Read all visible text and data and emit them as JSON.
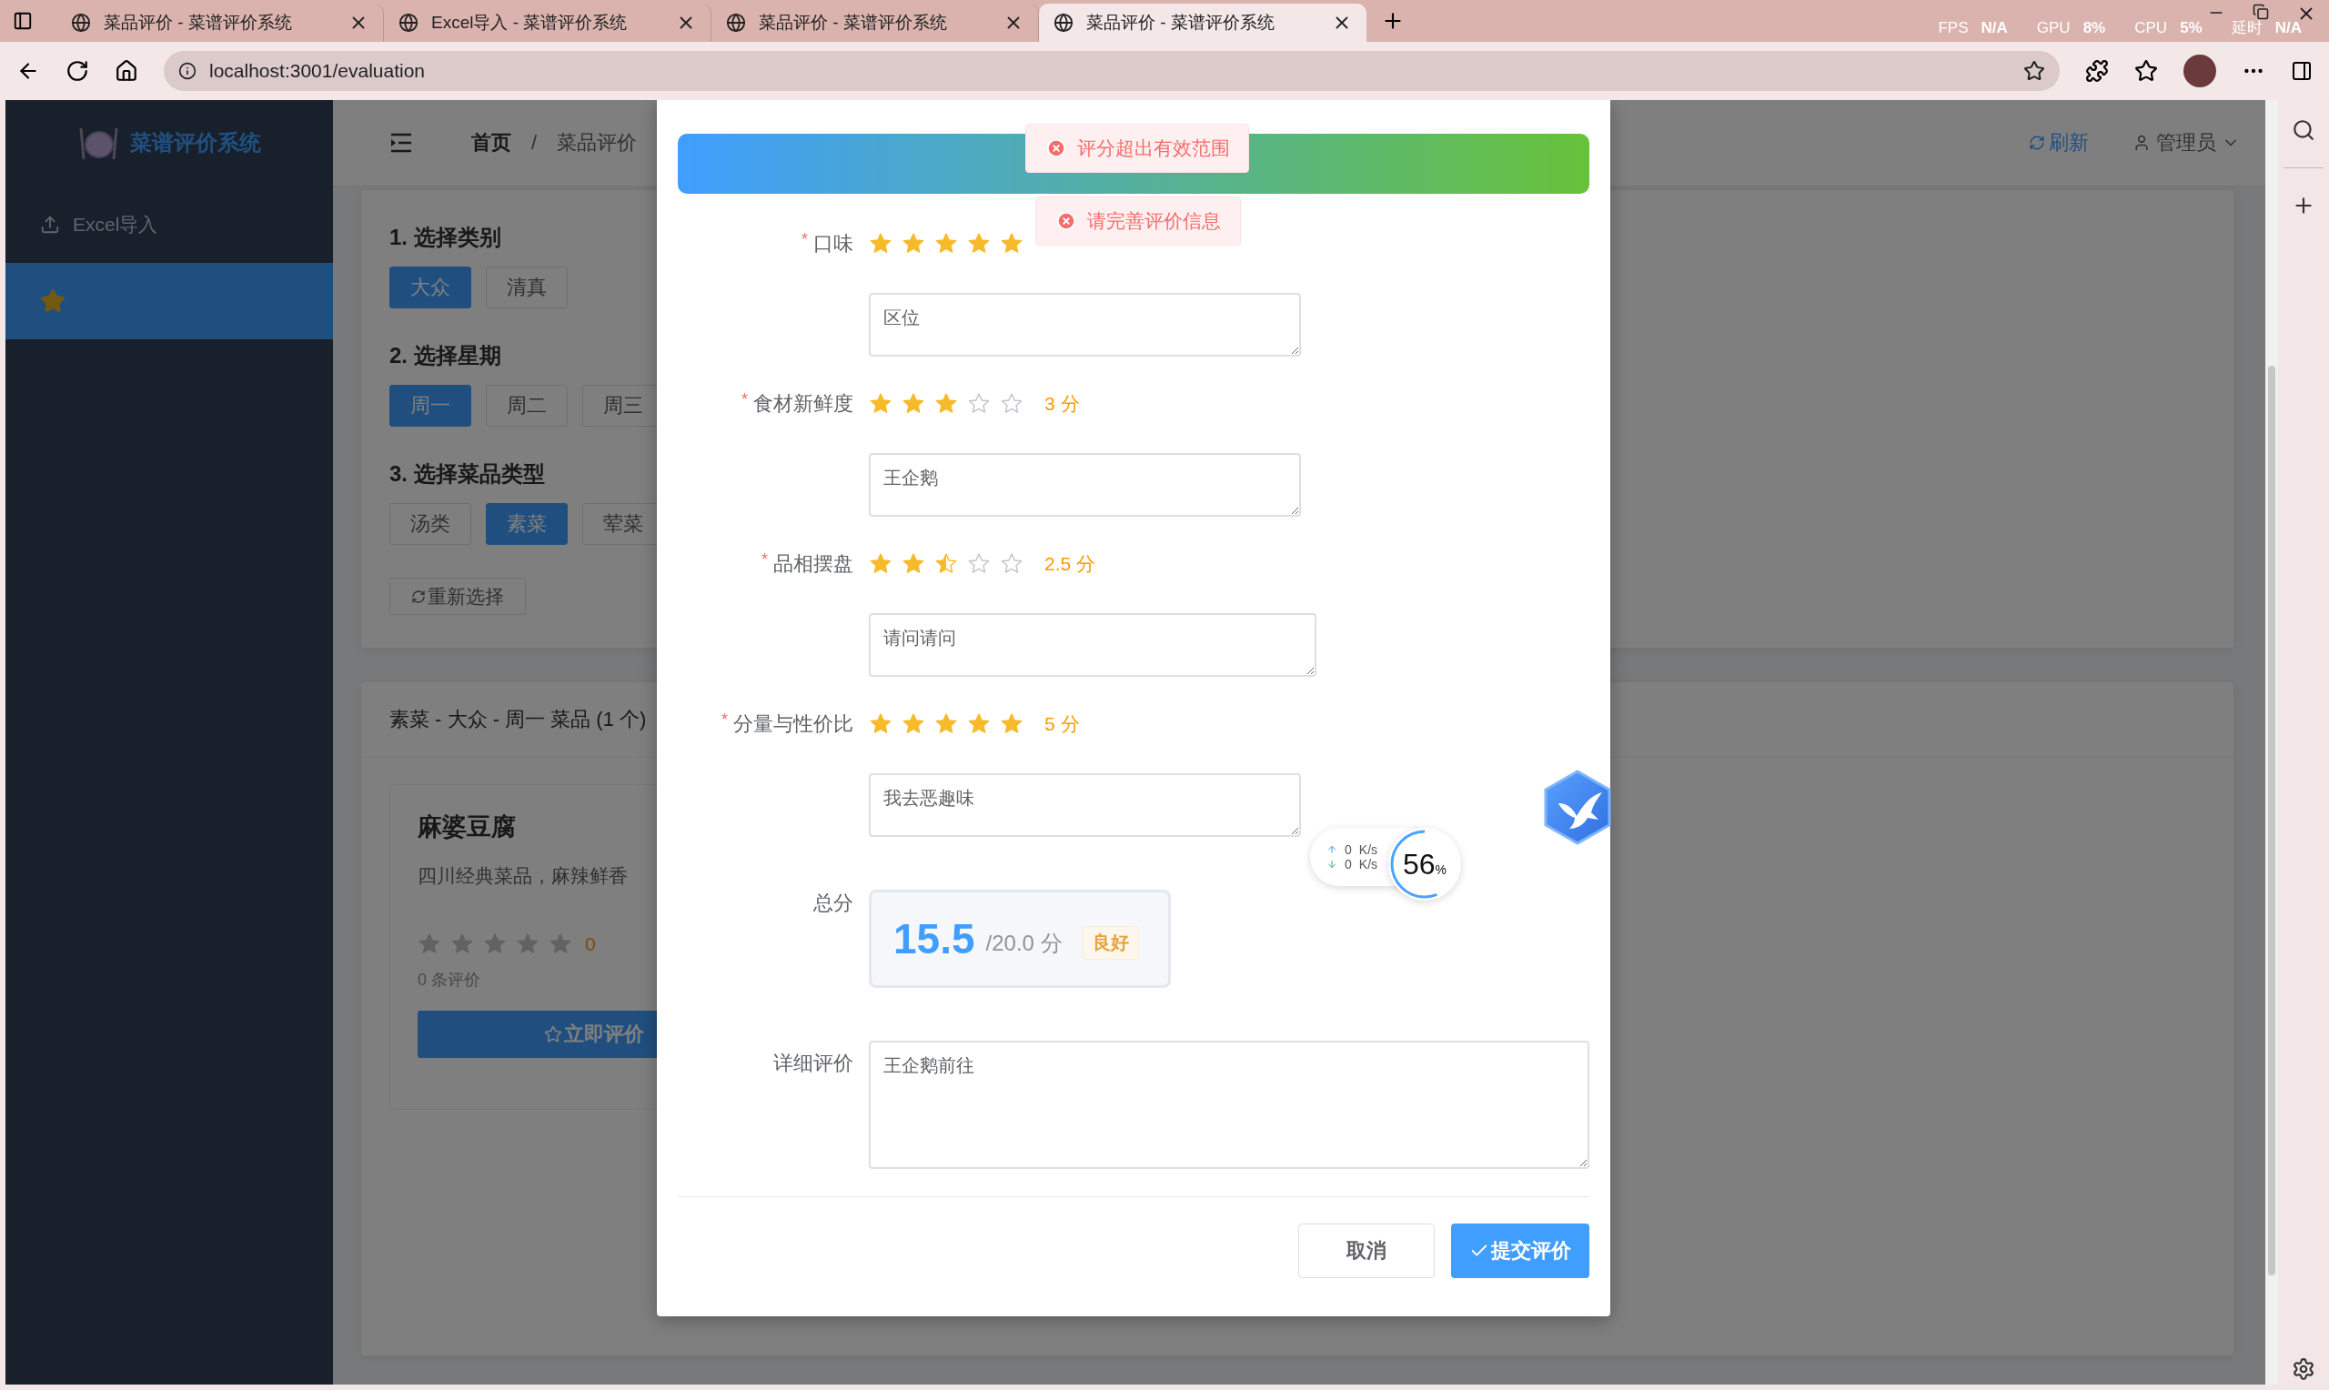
{
  "browser": {
    "tabs": [
      {
        "title": "菜品评价 - 菜谱评价系统",
        "selected": false
      },
      {
        "title": "Excel导入 - 菜谱评价系统",
        "selected": false
      },
      {
        "title": "菜品评价 - 菜谱评价系统",
        "selected": false
      },
      {
        "title": "菜品评价 - 菜谱评价系统",
        "selected": true
      }
    ],
    "stats": [
      {
        "label": "FPS",
        "value": "N/A"
      },
      {
        "label": "GPU",
        "value": "8%"
      },
      {
        "label": "CPU",
        "value": "5%"
      },
      {
        "label": "延时",
        "value": "N/A"
      }
    ],
    "url": "localhost:3001/evaluation"
  },
  "sidebar": {
    "logo": "菜谱评价系统",
    "items": [
      {
        "kind": "upload",
        "label": "Excel导入",
        "selected": false
      },
      {
        "kind": "star",
        "selected": true
      }
    ]
  },
  "header": {
    "breadcrumb": [
      "首页",
      "菜品评价"
    ],
    "separator": "/",
    "refresh": "刷新",
    "user": "管理员"
  },
  "filters": [
    {
      "title": "1. 选择类别",
      "options": [
        {
          "label": "大众",
          "selected": true
        },
        {
          "label": "清真",
          "selected": false
        }
      ]
    },
    {
      "title": "2. 选择星期",
      "options": [
        {
          "label": "周一",
          "selected": true
        },
        {
          "label": "周二",
          "selected": false
        },
        {
          "label": "周三",
          "selected": false
        }
      ]
    },
    {
      "title": "3. 选择菜品类型",
      "options": [
        {
          "label": "汤类",
          "selected": false
        },
        {
          "label": "素菜",
          "selected": true
        },
        {
          "label": "荤菜",
          "selected": false
        }
      ]
    }
  ],
  "reset": "重新选择",
  "dishes": {
    "title": "素菜 - 大众 - 周一 菜品 (1 个)",
    "items": [
      {
        "name": "麻婆豆腐",
        "description": "四川经典菜品，麻辣鲜香",
        "stars": 0,
        "rating": "0",
        "reviews": "0 条评价",
        "action": "立即评价"
      }
    ]
  },
  "dialog": {
    "criteria": [
      {
        "label": "口味",
        "required_mark": "*",
        "stars": 5,
        "comment": "区位"
      },
      {
        "label": "食材新鲜度",
        "required_mark": "*",
        "stars": 3,
        "score": "3 分",
        "comment": "王企鹅"
      },
      {
        "label": "品相摆盘",
        "required_mark": "*",
        "stars": 2.5,
        "score": "2.5 分",
        "comment": "请问请问"
      },
      {
        "label": "分量与性价比",
        "required_mark": "*",
        "stars": 5,
        "score": "5 分",
        "comment": "我去恶趣味"
      }
    ],
    "total": {
      "label": "总分",
      "value": "15.5",
      "max": "/20.0 分",
      "grade": "良好"
    },
    "detail": {
      "label": "详细评价",
      "value": "王企鹅前往"
    },
    "cancel": "取消",
    "submit": "提交评价"
  },
  "toasts": [
    {
      "text": "评分超出有效范围"
    },
    {
      "text": "请完善评价信息"
    }
  ],
  "monitor": {
    "upload": "0",
    "upload_unit": "K/s",
    "download": "0",
    "download_unit": "K/s",
    "usage": "56",
    "percent": "%",
    "level": 0.56
  }
}
